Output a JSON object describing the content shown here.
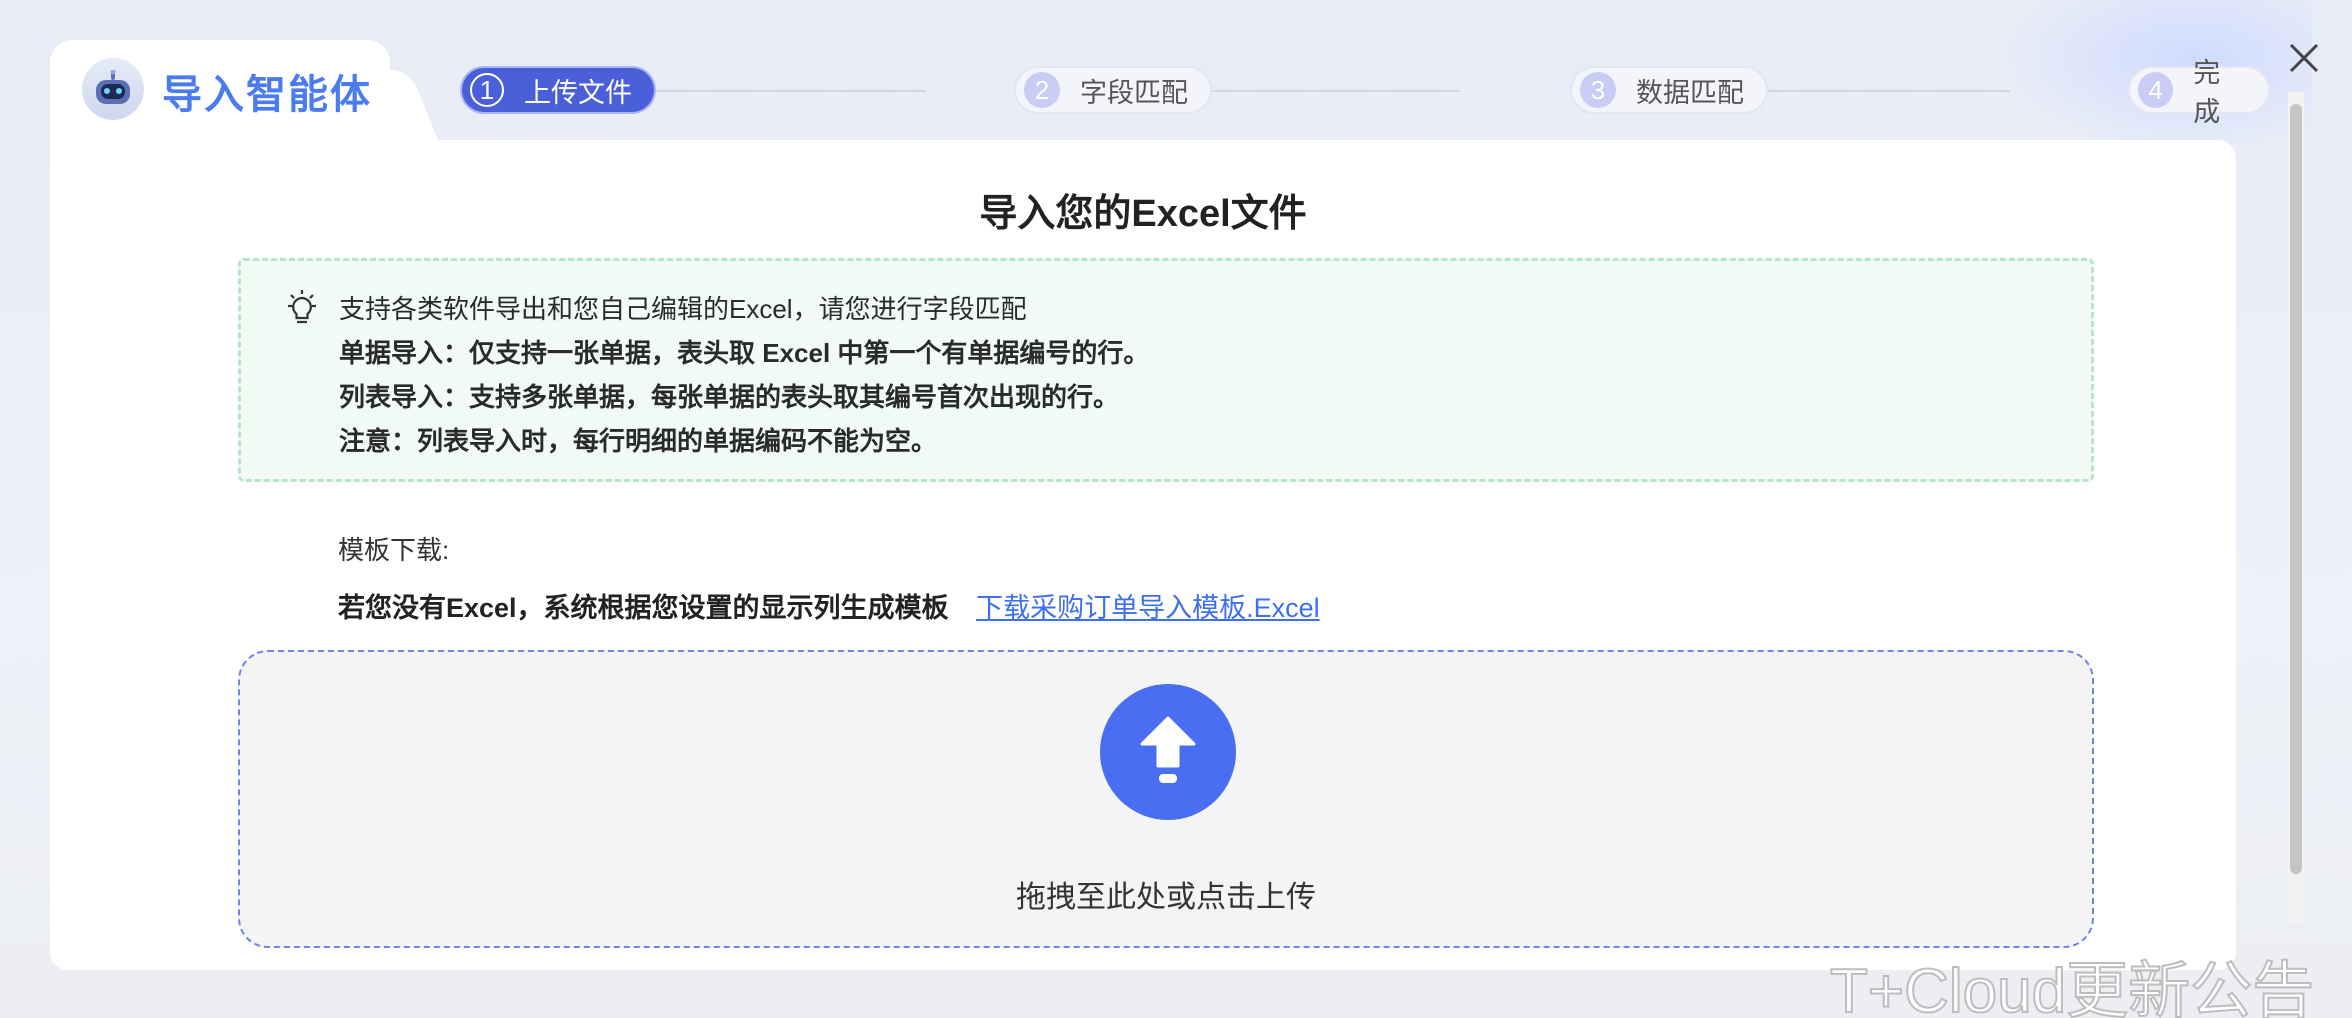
{
  "brand": {
    "title": "导入智能体",
    "logo_icon": "robot-icon"
  },
  "steps": [
    {
      "num": "1",
      "label": "上传文件",
      "active": true
    },
    {
      "num": "2",
      "label": "字段匹配",
      "active": false
    },
    {
      "num": "3",
      "label": "数据匹配",
      "active": false
    },
    {
      "num": "4",
      "label": "完成",
      "active": false
    }
  ],
  "main": {
    "title": "导入您的Excel文件",
    "notice": {
      "icon": "lightbulb-icon",
      "line1": "支持各类软件导出和您自己编辑的Excel，请您进行字段匹配",
      "line2": "单据导入：仅支持一张单据，表头取 Excel 中第一个有单据编号的行。",
      "line3": "列表导入：支持多张单据，每张单据的表头取其编号首次出现的行。",
      "line4": "注意：列表导入时，每行明细的单据编码不能为空。"
    },
    "template": {
      "label": "模板下载:",
      "hint": "若您没有Excel，系统根据您设置的显示列生成模板",
      "link": "下载采购订单导入模板.Excel"
    },
    "dropzone": {
      "icon": "upload-arrow-icon",
      "text": "拖拽至此处或点击上传"
    }
  },
  "watermark": "T+Cloud更新公告",
  "colors": {
    "accent": "#4a6ef2",
    "active_step": "#4b5fd9",
    "notice_bg": "#f1faf4",
    "notice_border": "#b7e6c6",
    "link": "#3d6ff0"
  }
}
